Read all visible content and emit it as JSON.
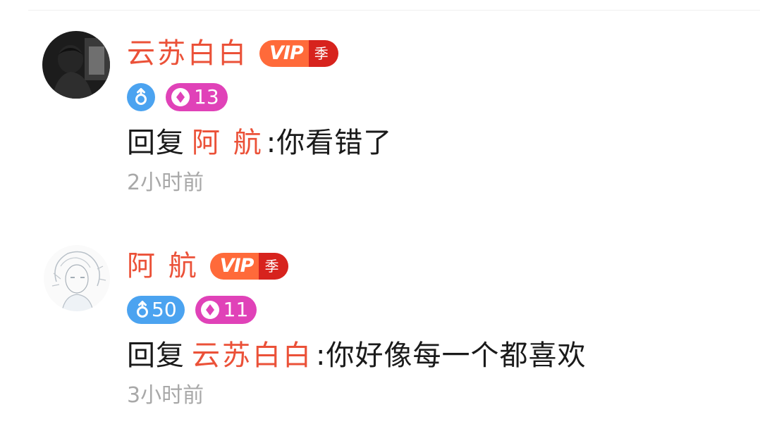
{
  "comments": [
    {
      "username": "云苏白白",
      "vip_label": "VIP",
      "vip_season": "季",
      "level_number": "",
      "fan_level": "13",
      "reply_prefix": "回复",
      "reply_to": "阿 航",
      "reply_text": ":你看错了",
      "time": "2小时前"
    },
    {
      "username": "阿 航",
      "vip_label": "VIP",
      "vip_season": "季",
      "level_number": "50",
      "fan_level": "11",
      "reply_prefix": "回复",
      "reply_to": "云苏白白",
      "reply_text": ":你好像每一个都喜欢",
      "time": "3小时前"
    }
  ],
  "colors": {
    "username": "#eb5138",
    "vip_orange": "#ff6a3a",
    "vip_red": "#d7231d",
    "level_blue": "#4ba3f0",
    "fan_magenta": "#e042b8",
    "time_gray": "#a8a8a8"
  },
  "icons": {
    "level": "male-symbol-icon",
    "fan": "diamond-icon"
  }
}
